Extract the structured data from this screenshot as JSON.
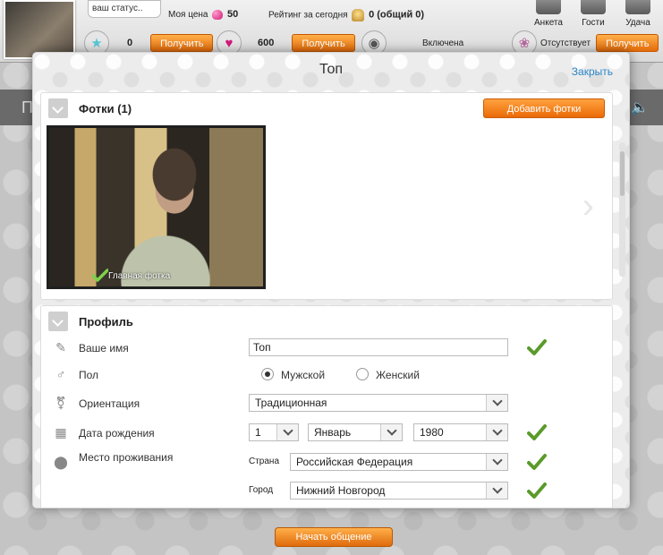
{
  "topbar": {
    "status_placeholder": "ваш статус..",
    "my_price_label": "Моя цена",
    "my_price_value": "50",
    "rating_label": "Рейтинг за сегодня",
    "rating_value": "0 (общий 0)",
    "tabs": [
      {
        "label": "Анкета"
      },
      {
        "label": "Гости"
      },
      {
        "label": "Удача"
      }
    ],
    "row2": {
      "stars_value": "0",
      "get_label": "Получить",
      "hearts_value": "600",
      "eye_status": "Включена",
      "away_status": "Отсутствует"
    }
  },
  "modal": {
    "title": "Топ",
    "close_label": "Закрыть",
    "photos": {
      "title": "Фотки (1)",
      "add_button": "Добавить фотки",
      "main_photo_label": "Главная фотка"
    },
    "profile": {
      "title": "Профиль",
      "name_label": "Ваше имя",
      "name_value": "Топ",
      "gender_label": "Пол",
      "gender_male": "Мужской",
      "gender_female": "Женский",
      "gender_selected": "male",
      "orientation_label": "Ориентация",
      "orientation_value": "Традиционная",
      "birthdate_label": "Дата рождения",
      "birth_day": "1",
      "birth_month": "Январь",
      "birth_year": "1980",
      "location_label": "Место проживания",
      "country_label": "Страна",
      "country_value": "Российская Федерация",
      "city_label": "Город",
      "city_value": "Нижний Новгород"
    }
  },
  "footer": {
    "start_chat": "Начать общение"
  },
  "colors": {
    "accent_orange": "#ea6a08",
    "link_blue": "#2a86c9",
    "check_green": "#5a9a2a"
  }
}
